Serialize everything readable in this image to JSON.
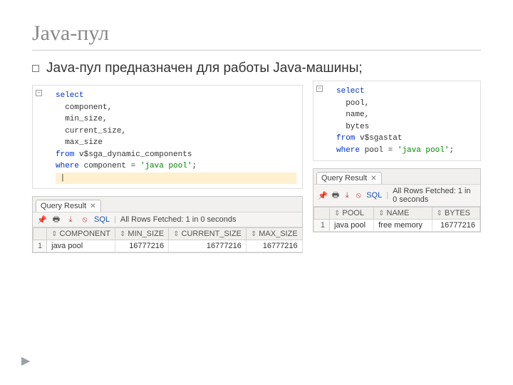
{
  "title": "Java-пул",
  "bullet": "Java-пул предназначен для работы Java-машины;",
  "left": {
    "sql": {
      "l1_kw": "select",
      "l2": "  component,",
      "l3": "  min_size,",
      "l4": "  current_size,",
      "l5": "  max_size",
      "l6_kw": "from",
      "l6_rest": " v$sga_dynamic_components",
      "l7_kw": "where",
      "l7_rest": " component = ",
      "l7_str": "'java pool'",
      "l7_end": ";"
    },
    "result": {
      "tab": "Query Result",
      "sql_label": "SQL",
      "status": "All Rows Fetched: 1 in 0 seconds",
      "cols": [
        "COMPONENT",
        "MIN_SIZE",
        "CURRENT_SIZE",
        "MAX_SIZE"
      ],
      "rownum": "1",
      "row": [
        "java pool",
        "16777216",
        "16777216",
        "16777216"
      ]
    }
  },
  "right": {
    "sql": {
      "l1_kw": "select",
      "l2": "  pool,",
      "l3": "  name,",
      "l4": "  bytes",
      "l5_kw": "from",
      "l5_rest": " v$sgastat",
      "l6_kw": "where",
      "l6_rest": " pool = ",
      "l6_str": "'java pool'",
      "l6_end": ";"
    },
    "result": {
      "tab": "Query Result",
      "sql_label": "SQL",
      "status": "All Rows Fetched: 1 in 0 seconds",
      "cols": [
        "POOL",
        "NAME",
        "BYTES"
      ],
      "rownum": "1",
      "row": [
        "java pool",
        "free memory",
        "16777216"
      ]
    }
  }
}
